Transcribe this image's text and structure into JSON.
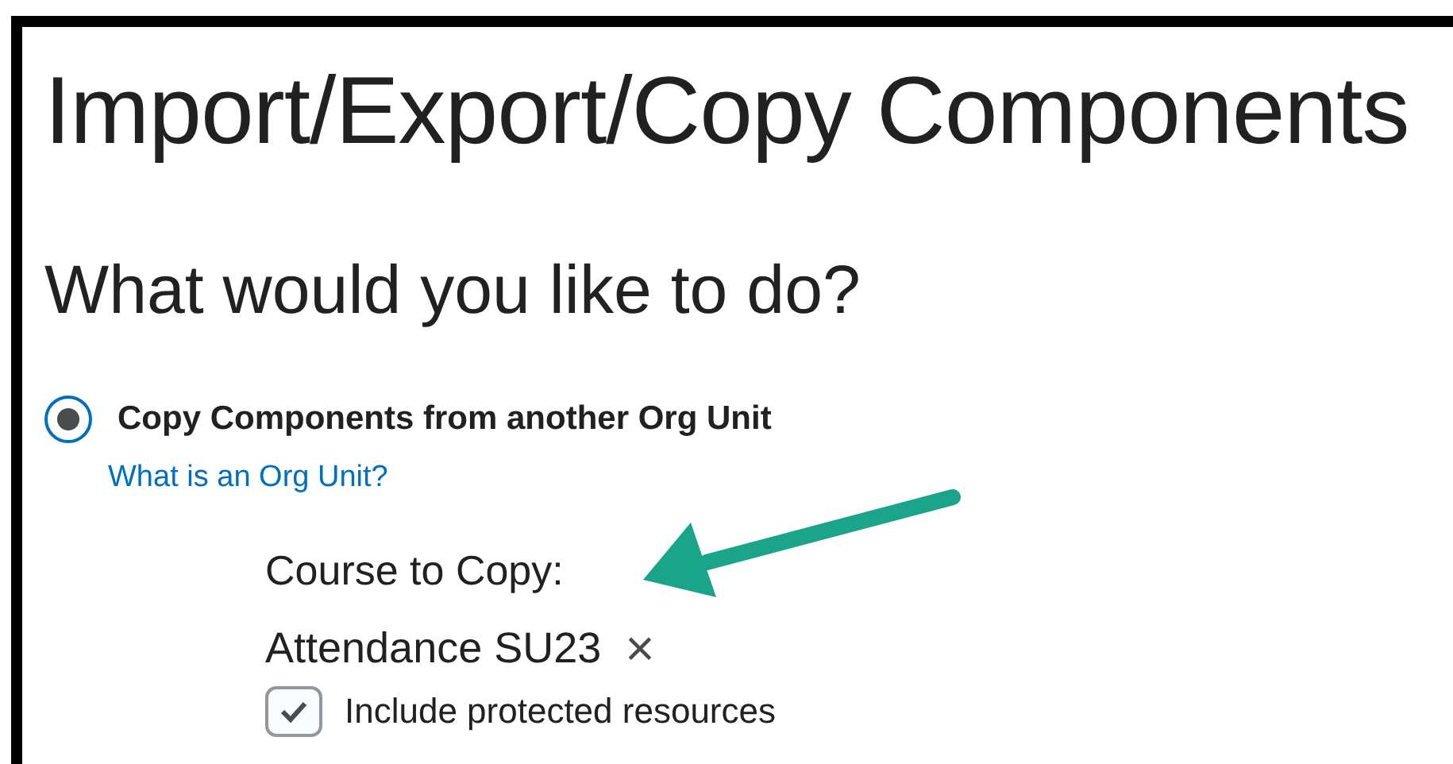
{
  "page_title": "Import/Export/Copy Components",
  "question": "What would you like to do?",
  "options": [
    {
      "label": "Copy Components from another Org Unit",
      "selected": true,
      "help_link": "What is an Org Unit?"
    }
  ],
  "course_field": {
    "label": "Course to Copy:",
    "value": "Attendance SU23",
    "clear": "×"
  },
  "include_protected": {
    "label": "Include protected resources",
    "checked": true
  },
  "annotation": {
    "kind": "arrow",
    "color": "#1aa58a"
  }
}
